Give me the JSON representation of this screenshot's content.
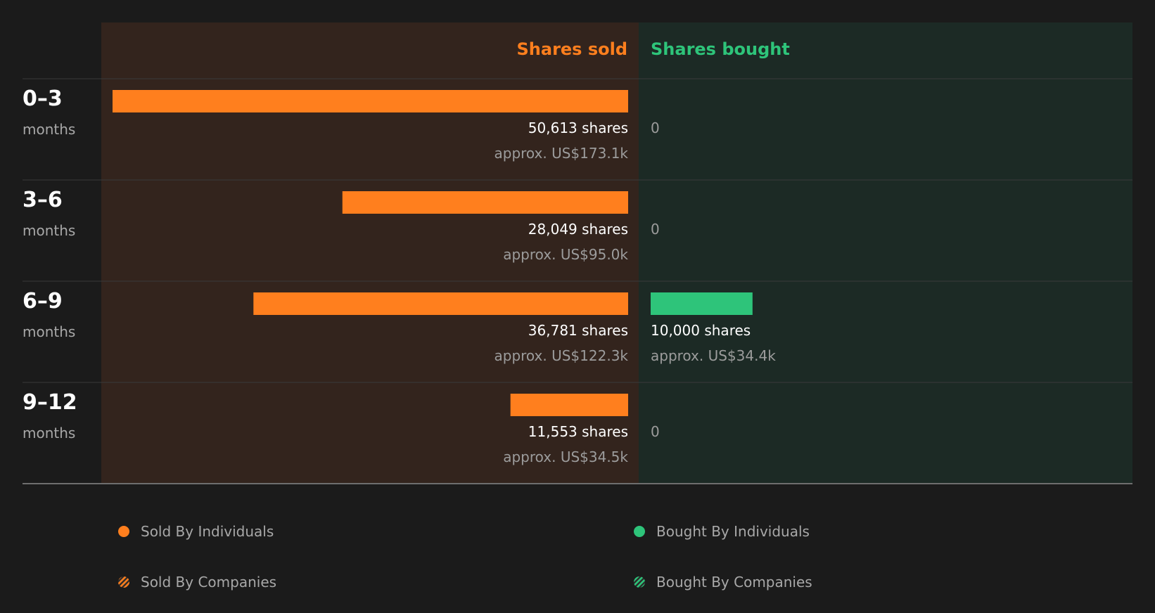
{
  "chart_data": {
    "type": "bar",
    "orientation": "horizontal-diverging",
    "columns": {
      "sold": "Shares sold",
      "bought": "Shares bought"
    },
    "categories": [
      {
        "period": "0–3",
        "unit": "months"
      },
      {
        "period": "3–6",
        "unit": "months"
      },
      {
        "period": "6–9",
        "unit": "months"
      },
      {
        "period": "9–12",
        "unit": "months"
      }
    ],
    "sold": [
      {
        "shares": 50613,
        "shares_label": "50,613 shares",
        "value_label": "approx. US$173.1k"
      },
      {
        "shares": 28049,
        "shares_label": "28,049 shares",
        "value_label": "approx. US$95.0k"
      },
      {
        "shares": 36781,
        "shares_label": "36,781 shares",
        "value_label": "approx. US$122.3k"
      },
      {
        "shares": 11553,
        "shares_label": "11,553 shares",
        "value_label": "approx. US$34.5k"
      }
    ],
    "bought": [
      {
        "shares": 0,
        "shares_label": "0",
        "value_label": ""
      },
      {
        "shares": 0,
        "shares_label": "0",
        "value_label": ""
      },
      {
        "shares": 10000,
        "shares_label": "10,000 shares",
        "value_label": "approx. US$34.4k"
      },
      {
        "shares": 0,
        "shares_label": "0",
        "value_label": ""
      }
    ],
    "legend": [
      {
        "label": "Sold By Individuals",
        "style": "dot",
        "color": "#ff7f1e"
      },
      {
        "label": "Bought By Individuals",
        "style": "dot",
        "color": "#2ec47a"
      },
      {
        "label": "Sold By Companies",
        "style": "striped",
        "color": "#ff7f1e"
      },
      {
        "label": "Bought By Companies",
        "style": "striped",
        "color": "#2ec47a"
      }
    ],
    "colors": {
      "sold": "#ff7f1e",
      "bought": "#2ec47a",
      "sold_panel": "#33241d",
      "bought_panel": "#1c2a25",
      "background": "#1b1b1b"
    },
    "grid": true,
    "legend_position": "bottom"
  }
}
